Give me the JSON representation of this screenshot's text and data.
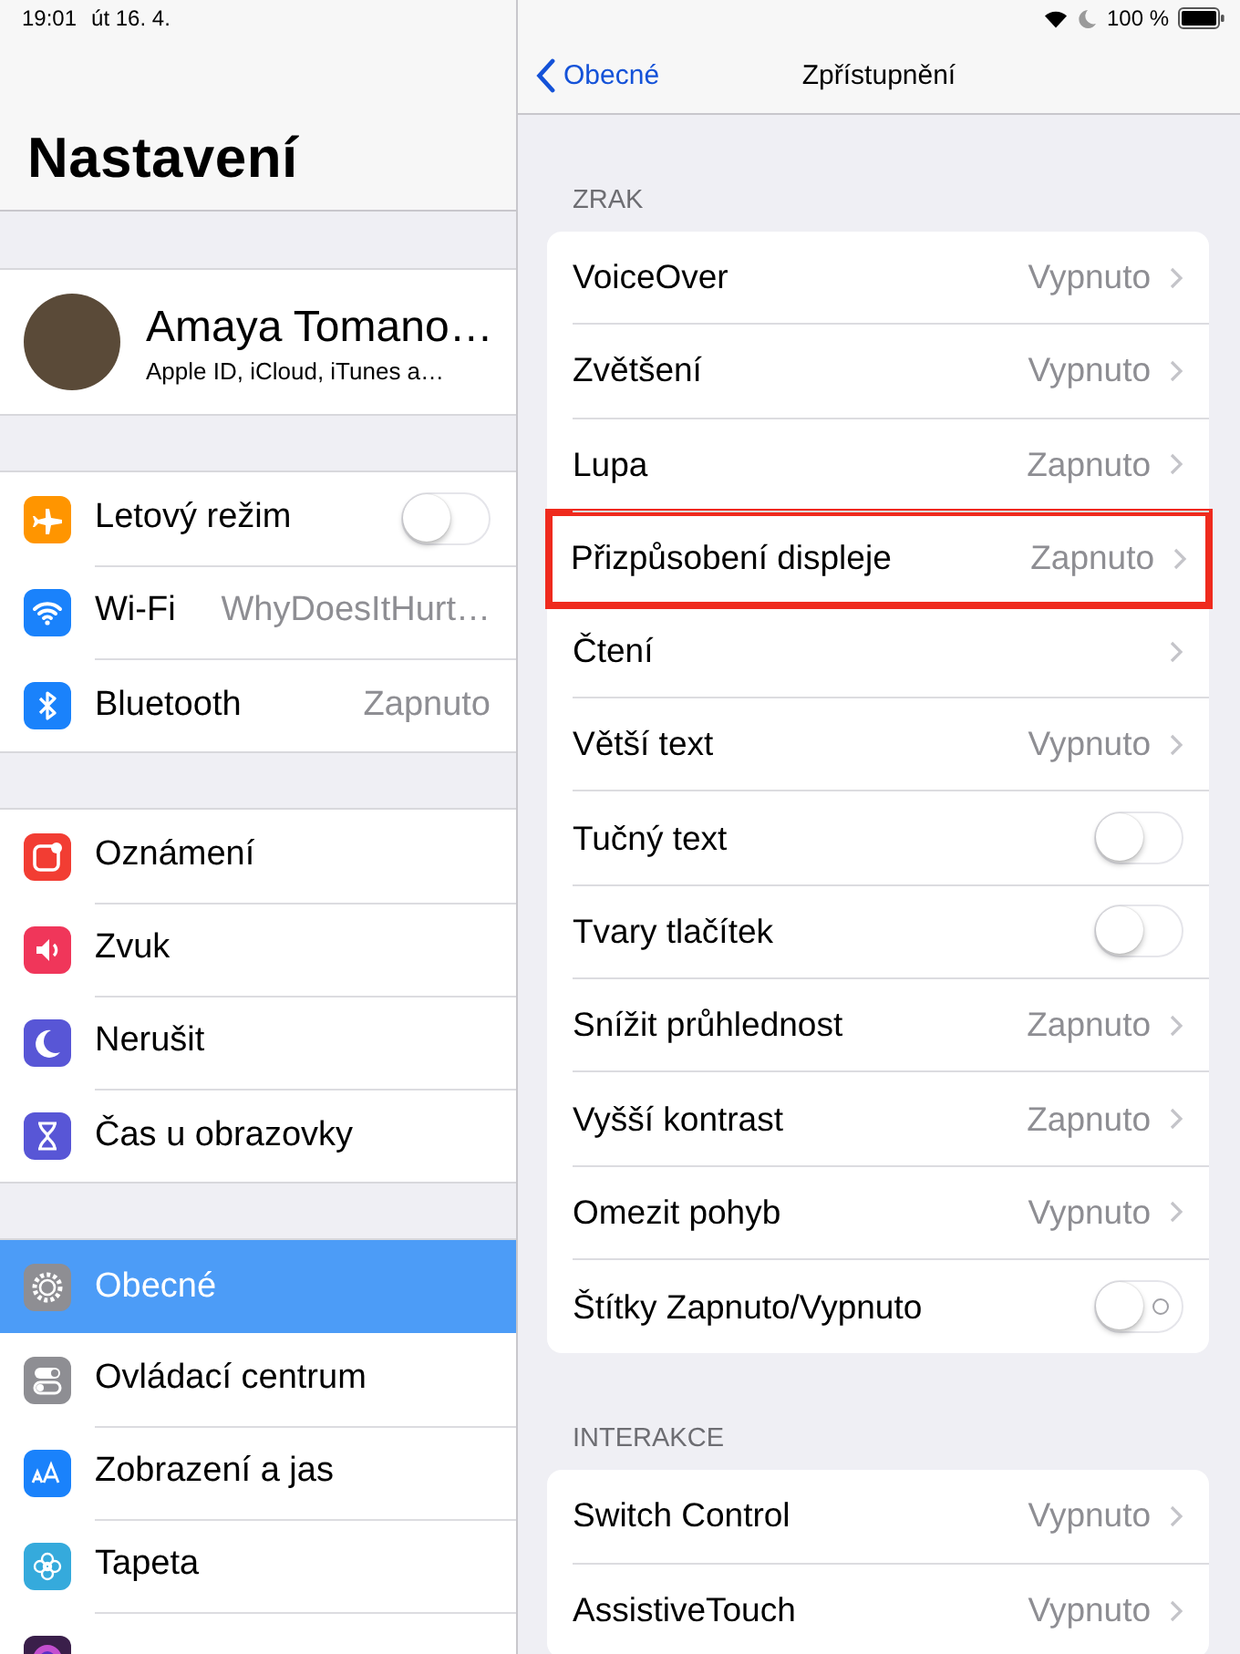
{
  "status_bar": {
    "time": "19:01",
    "date": "út 16. 4.",
    "battery": "100 %"
  },
  "sidebar": {
    "title": "Nastavení",
    "profile": {
      "name": "Amaya Tomano…",
      "subtitle": "Apple ID, iCloud, iTunes a…"
    },
    "groups": [
      [
        {
          "kind": "airplane",
          "label": "Letový režim",
          "on": false,
          "selected": false
        },
        {
          "kind": "wifi",
          "label": "Wi-Fi",
          "value": "WhyDoesItHurt…",
          "selected": false
        },
        {
          "kind": "bluetooth",
          "label": "Bluetooth",
          "value": "Zapnuto",
          "selected": false
        }
      ],
      [
        {
          "kind": "notifications",
          "label": "Oznámení",
          "selected": false
        },
        {
          "kind": "sound",
          "label": "Zvuk",
          "selected": false
        },
        {
          "kind": "moon",
          "label": "Nerušit",
          "selected": false
        },
        {
          "kind": "hourglass",
          "label": "Čas u obrazovky",
          "selected": false
        }
      ],
      [
        {
          "kind": "gear",
          "label": "Obecné",
          "selected": true
        },
        {
          "kind": "switches",
          "label": "Ovládací centrum",
          "selected": false
        },
        {
          "kind": "textsize",
          "label": "Zobrazení a jas",
          "selected": false
        },
        {
          "kind": "flower",
          "label": "Tapeta",
          "selected": false
        },
        {
          "kind": "siri",
          "selected": false
        }
      ]
    ]
  },
  "detail": {
    "back": "Obecné",
    "title": "Zpřístupnění",
    "sections": [
      {
        "header": "ZRAK",
        "rows": [
          {
            "kind": "link",
            "label": "VoiceOver",
            "value": "Vypnuto",
            "highlighted": false
          },
          {
            "kind": "link",
            "label": "Zvětšení",
            "value": "Vypnuto",
            "highlighted": false
          },
          {
            "kind": "link",
            "label": "Lupa",
            "value": "Zapnuto",
            "highlighted": false
          },
          {
            "kind": "link",
            "label": "Přizpůsobení displeje",
            "value": "Zapnuto",
            "highlighted": true
          },
          {
            "kind": "link",
            "label": "Čtení",
            "highlighted": false
          },
          {
            "kind": "link",
            "label": "Větší text",
            "value": "Vypnuto",
            "highlighted": false
          },
          {
            "kind": "toggle",
            "label": "Tučný text",
            "on": false,
            "off_mark": false,
            "highlighted": false
          },
          {
            "kind": "toggle",
            "label": "Tvary tlačítek",
            "on": false,
            "off_mark": false,
            "highlighted": false
          },
          {
            "kind": "link",
            "label": "Snížit průhlednost",
            "value": "Zapnuto",
            "highlighted": false
          },
          {
            "kind": "link",
            "label": "Vyšší kontrast",
            "value": "Zapnuto",
            "highlighted": false
          },
          {
            "kind": "link",
            "label": "Omezit pohyb",
            "value": "Vypnuto",
            "highlighted": false
          },
          {
            "kind": "toggle",
            "label": "Štítky Zapnuto/Vypnuto",
            "on": false,
            "off_mark": true,
            "highlighted": false
          }
        ]
      },
      {
        "header": "INTERAKCE",
        "rows": [
          {
            "kind": "link",
            "label": "Switch Control",
            "value": "Vypnuto",
            "highlighted": false
          },
          {
            "kind": "link",
            "label": "AssistiveTouch",
            "value": "Vypnuto",
            "highlighted": false
          }
        ]
      }
    ]
  }
}
